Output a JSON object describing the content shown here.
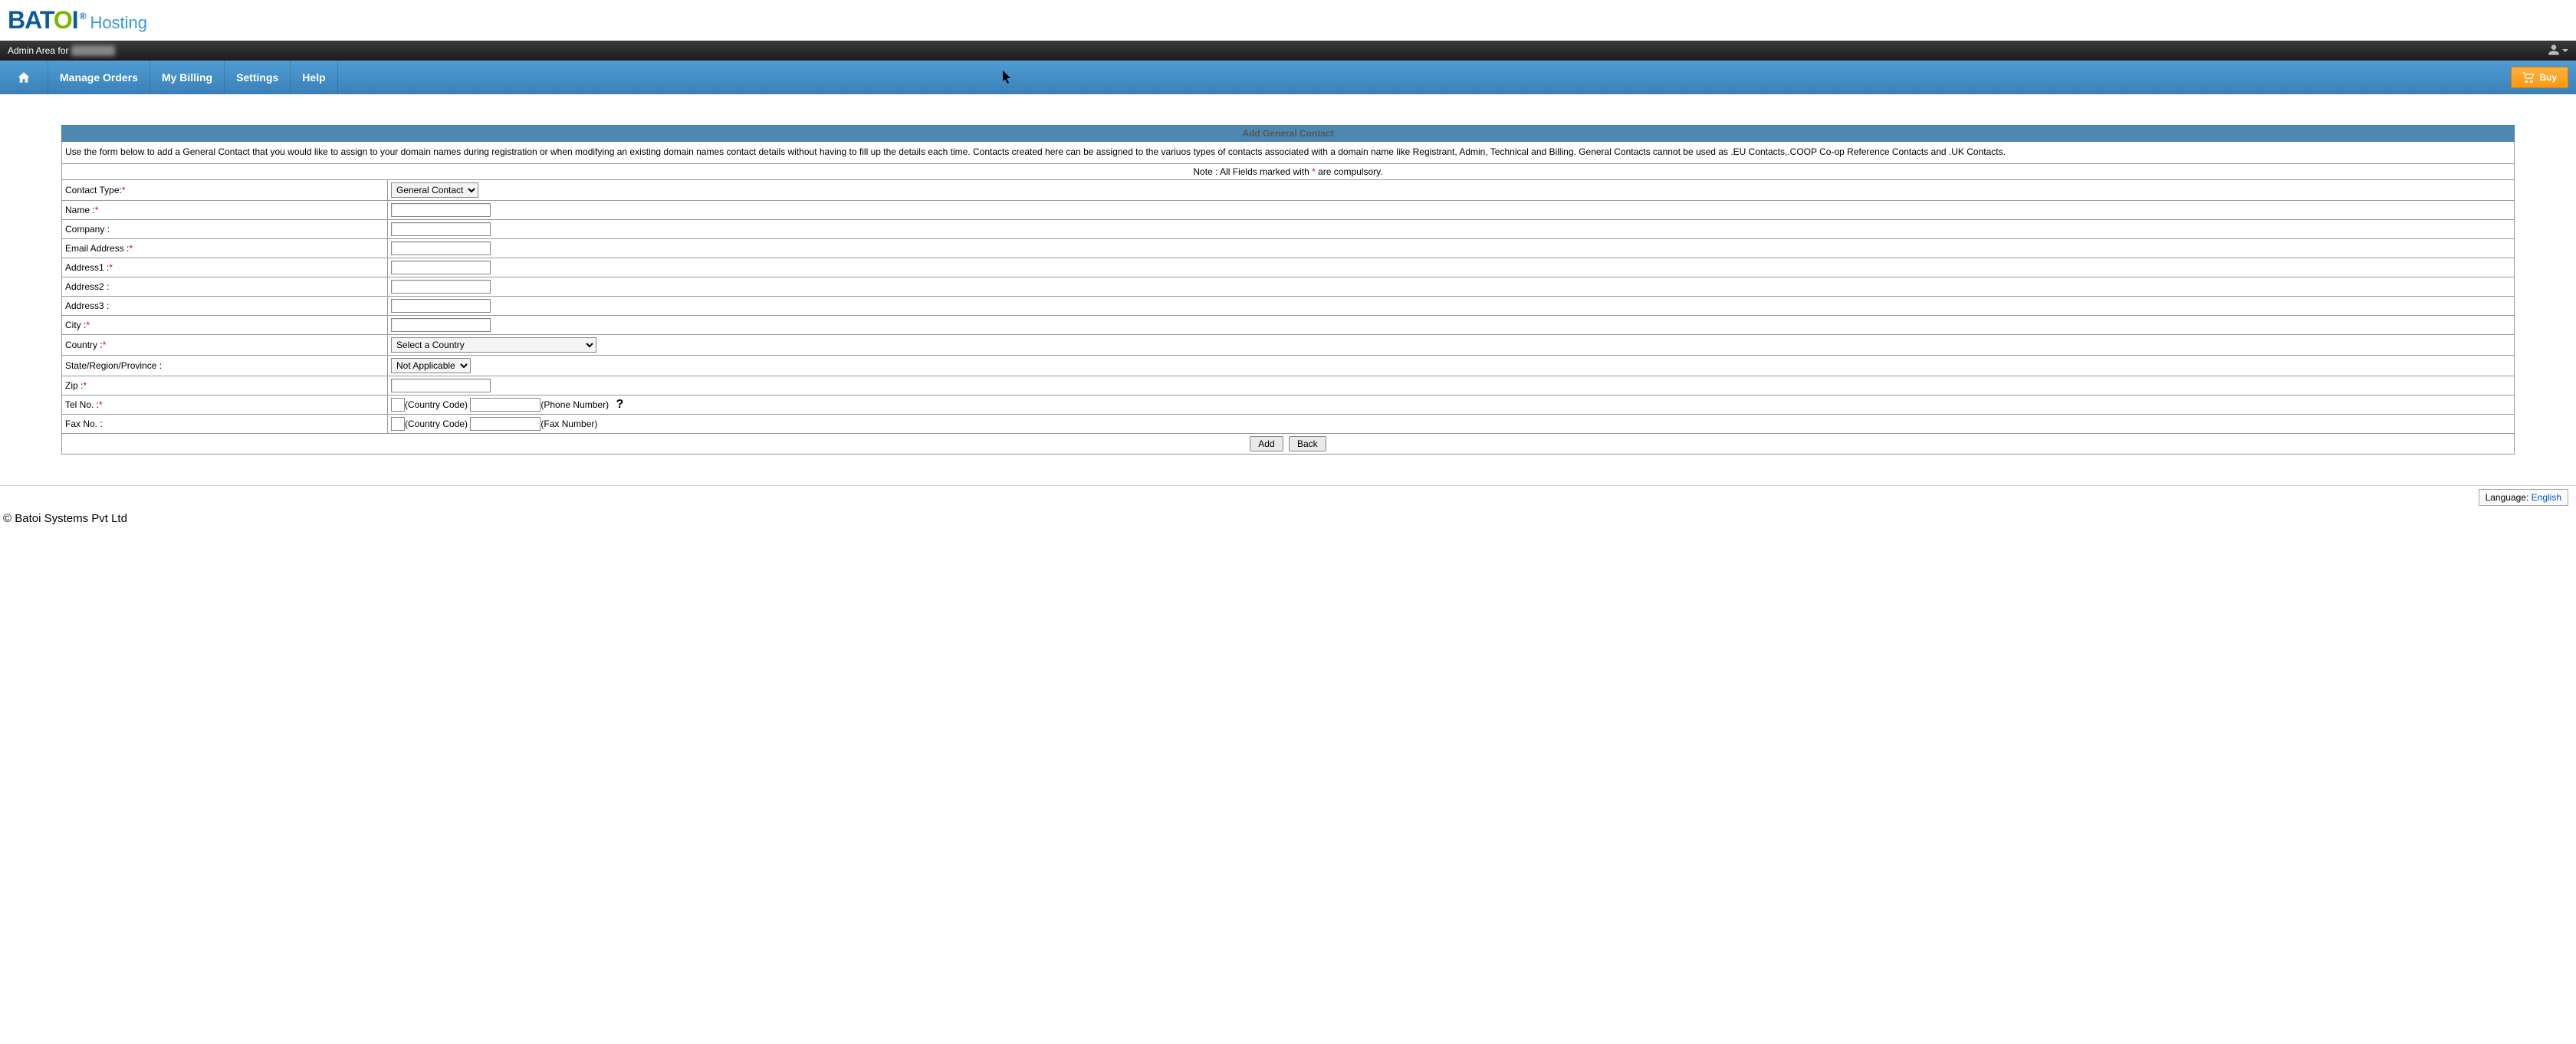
{
  "header": {
    "logo_text": "BAT",
    "logo_accent": "O",
    "logo_tail": "I",
    "logo_suffix": "Hosting",
    "admin_prefix": "Admin Area for",
    "admin_user": "hidden",
    "nav": {
      "home": "Home",
      "manage_orders": "Manage Orders",
      "my_billing": "My Billing",
      "settings": "Settings",
      "help": "Help",
      "buy": "Buy"
    }
  },
  "form": {
    "title": "Add General Contact",
    "description": "Use the form below to add a General Contact that you would like to assign to your domain names during registration or when modifying an existing domain names contact details without having to fill up the details each time. Contacts created here can be assigned to the variuos types of contacts associated with a domain name like Registrant, Admin, Technical and Billing. General Contacts cannot be used as .EU Contacts,.COOP Co-op Reference Contacts and .UK Contacts.",
    "note_prefix": "Note : All Fields marked with ",
    "note_suffix": " are compulsory.",
    "labels": {
      "contact_type": "Contact Type:",
      "name": "Name :",
      "company": "Company :",
      "email": "Email Address :",
      "address1": "Address1 :",
      "address2": "Address2 :",
      "address3": "Address3 :",
      "city": "City :",
      "country": "Country :",
      "state": "State/Region/Province :",
      "zip": "Zip :",
      "tel": "Tel No. :",
      "fax": "Fax No. :"
    },
    "hints": {
      "country_code": "(Country Code)",
      "phone_number": "(Phone Number)",
      "fax_number": "(Fax Number)"
    },
    "selects": {
      "contact_type_value": "General Contact",
      "country_value": "Select a Country",
      "state_value": "Not Applicable"
    },
    "buttons": {
      "add": "Add",
      "back": "Back"
    }
  },
  "footer": {
    "language_label": "Language: ",
    "language_value": "English",
    "copyright": "© Batoi Systems Pvt Ltd"
  }
}
